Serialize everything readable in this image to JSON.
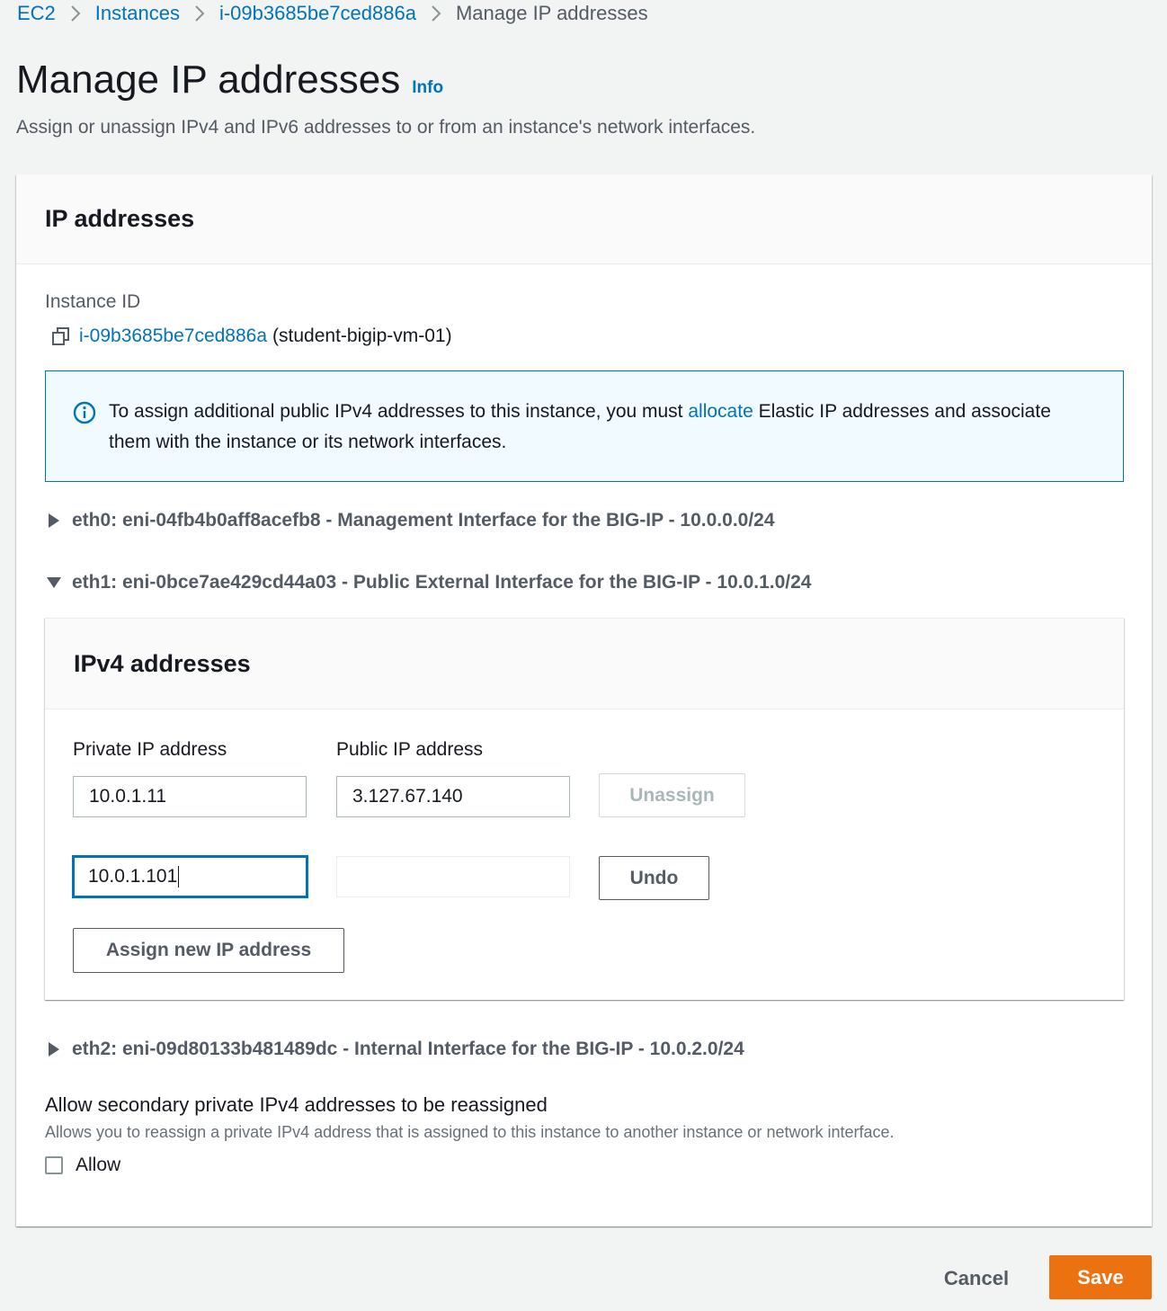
{
  "breadcrumb": {
    "items": [
      "EC2",
      "Instances",
      "i-09b3685be7ced886a"
    ],
    "current": "Manage IP addresses"
  },
  "header": {
    "title": "Manage IP addresses",
    "info": "Info",
    "description": "Assign or unassign IPv4 and IPv6 addresses to or from an instance's network interfaces."
  },
  "panel": {
    "title": "IP addresses",
    "instance_label": "Instance ID",
    "instance_id": "i-09b3685be7ced886a",
    "instance_name": "(student-bigip-vm-01)"
  },
  "alert": {
    "text_before": "To assign additional public IPv4 addresses to this instance, you must ",
    "link": "allocate",
    "text_after": " Elastic IP addresses and associate them with the instance or its network interfaces."
  },
  "interfaces": [
    {
      "label": "eth0: eni-04fb4b0aff8acefb8 - Management Interface for the BIG-IP - 10.0.0.0/24",
      "expanded": false
    },
    {
      "label": "eth1: eni-0bce7ae429cd44a03 - Public External Interface for the BIG-IP - 10.0.1.0/24",
      "expanded": true
    },
    {
      "label": "eth2: eni-09d80133b481489dc - Internal Interface for the BIG-IP - 10.0.2.0/24",
      "expanded": false
    }
  ],
  "ipv4": {
    "title": "IPv4 addresses",
    "private_label": "Private IP address",
    "public_label": "Public IP address",
    "rows": [
      {
        "private": "10.0.1.11",
        "public": "3.127.67.140",
        "action": "Unassign"
      },
      {
        "private": "10.0.1.101",
        "public": "",
        "action": "Undo"
      }
    ],
    "assign_button": "Assign new IP address"
  },
  "reassign": {
    "title": "Allow secondary private IPv4 addresses to be reassigned",
    "description": "Allows you to reassign a private IPv4 address that is assigned to this instance to another instance or network interface.",
    "checkbox_label": "Allow",
    "checked": false
  },
  "footer": {
    "cancel": "Cancel",
    "save": "Save"
  },
  "colors": {
    "link": "#0073bb",
    "primary_button": "#ec7211",
    "alert_background": "#f1faff"
  }
}
